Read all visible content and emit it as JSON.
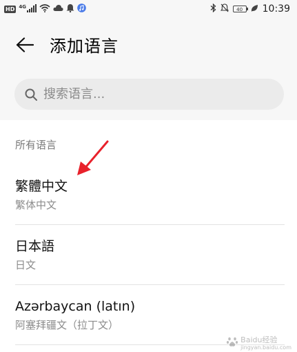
{
  "status_bar": {
    "hd_badge": "HD",
    "signal_label": "4G",
    "battery_level": "40",
    "time": "10:39",
    "icons": [
      "signal-icon",
      "wifi-icon",
      "cloud-icon",
      "notification-bell-icon",
      "music-app-icon",
      "bluetooth-icon",
      "do-not-disturb-icon",
      "battery-icon",
      "leaf-icon"
    ]
  },
  "app_bar": {
    "back_icon": "arrow-left-icon",
    "title": "添加语言"
  },
  "search": {
    "icon": "search-icon",
    "placeholder": "搜索语言..."
  },
  "section": {
    "header": "所有语言"
  },
  "languages": [
    {
      "name": "繁體中文",
      "native": "繁体中文"
    },
    {
      "name": "日本語",
      "native": "日文"
    },
    {
      "name": "Azərbaycan (latın)",
      "native": "阿塞拜疆文（拉丁文）"
    }
  ],
  "annotation": {
    "arrow_color": "#e8212b"
  },
  "watermark": {
    "text": "Baidu经验",
    "subtext": "jingyan.baidu.com"
  },
  "colors": {
    "background": "#f7f7f7",
    "search_fill": "#ebebeb",
    "secondary_text": "#8c8c8c"
  }
}
